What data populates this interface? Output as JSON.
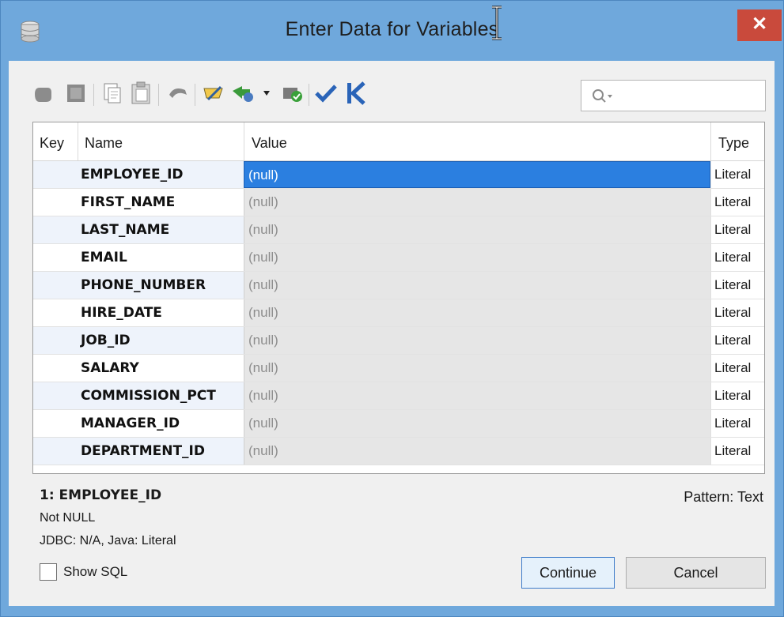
{
  "window": {
    "title": "Enter Data for Variables",
    "close_glyph": "✕"
  },
  "toolbar": {
    "search_placeholder": "",
    "icons": [
      "hand-icon",
      "grid-icon",
      "copy-icon",
      "paste-icon",
      "undo-icon",
      "edit-icon",
      "load-icon",
      "dropdown-arrow-icon",
      "apply-icon",
      "check-icon",
      "first-icon"
    ]
  },
  "grid": {
    "headers": {
      "key": "Key",
      "name": "Name",
      "value": "Value",
      "type": "Type"
    },
    "rows": [
      {
        "name": "EMPLOYEE_ID",
        "value": "(null)",
        "type": "Literal"
      },
      {
        "name": "FIRST_NAME",
        "value": "(null)",
        "type": "Literal"
      },
      {
        "name": "LAST_NAME",
        "value": "(null)",
        "type": "Literal"
      },
      {
        "name": "EMAIL",
        "value": "(null)",
        "type": "Literal"
      },
      {
        "name": "PHONE_NUMBER",
        "value": "(null)",
        "type": "Literal"
      },
      {
        "name": "HIRE_DATE",
        "value": "(null)",
        "type": "Literal"
      },
      {
        "name": "JOB_ID",
        "value": "(null)",
        "type": "Literal"
      },
      {
        "name": "SALARY",
        "value": "(null)",
        "type": "Literal"
      },
      {
        "name": "COMMISSION_PCT",
        "value": "(null)",
        "type": "Literal"
      },
      {
        "name": "MANAGER_ID",
        "value": "(null)",
        "type": "Literal"
      },
      {
        "name": "DEPARTMENT_ID",
        "value": "(null)",
        "type": "Literal"
      }
    ]
  },
  "details": {
    "selected": "1: EMPLOYEE_ID",
    "nullability": "Not NULL",
    "types": "JDBC: N/A, Java: Literal",
    "pattern": "Pattern: Text"
  },
  "footer": {
    "show_sql_label": "Show SQL",
    "show_sql_checked": false,
    "continue_label": "Continue",
    "cancel_label": "Cancel"
  },
  "colors": {
    "titlebar": "#6fa8dc",
    "close": "#c94a3c",
    "selection": "#2b7fe0"
  }
}
